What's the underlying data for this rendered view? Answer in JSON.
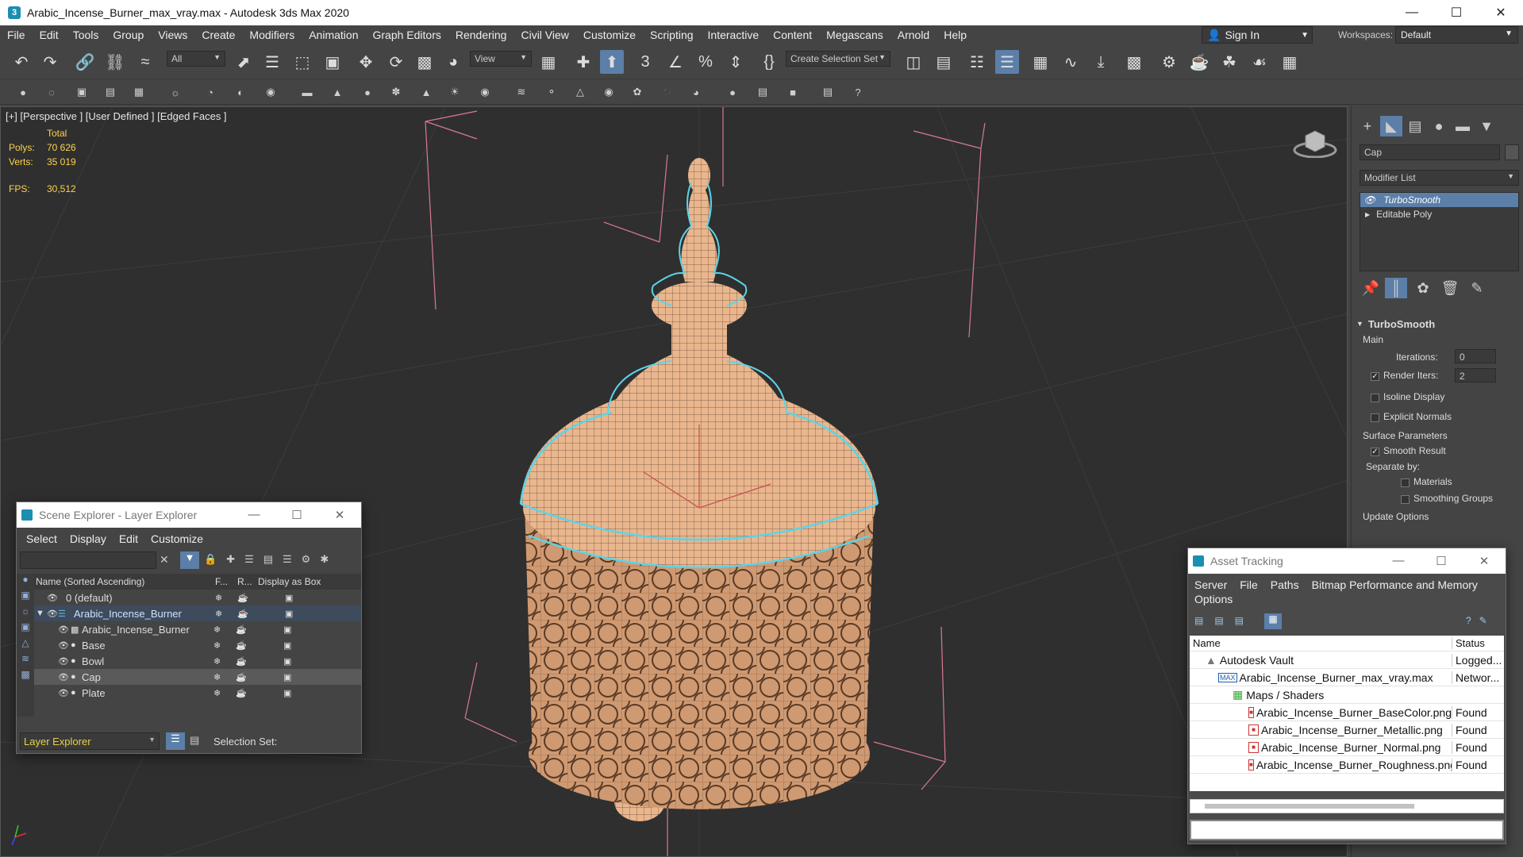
{
  "window": {
    "title": "Arabic_Incense_Burner_max_vray.max - Autodesk 3ds Max 2020"
  },
  "menu": [
    "File",
    "Edit",
    "Tools",
    "Group",
    "Views",
    "Create",
    "Modifiers",
    "Animation",
    "Graph Editors",
    "Rendering",
    "Civil View",
    "Customize",
    "Scripting",
    "Interactive",
    "Content",
    "Megascans",
    "Arnold",
    "Help"
  ],
  "account": {
    "sign_in": "Sign In",
    "workspaces_label": "Workspaces:",
    "workspace": "Default"
  },
  "toolbar": {
    "selection_filter": "All",
    "ref_coord": "View",
    "selection_set_placeholder": "Create Selection Set"
  },
  "viewport": {
    "label": "[+] [Perspective ] [User Defined ] [Edged Faces ]",
    "stats": {
      "total_label": "Total",
      "polys_label": "Polys:",
      "polys": "70 626",
      "verts_label": "Verts:",
      "verts": "35 019",
      "fps_label": "FPS:",
      "fps": "30,512"
    }
  },
  "command_panel": {
    "object_name": "Cap",
    "modifier_list": "Modifier List",
    "stack": [
      "TurboSmooth",
      "Editable Poly"
    ],
    "rollout_title": "TurboSmooth",
    "main_label": "Main",
    "iterations_label": "Iterations:",
    "iterations": "0",
    "render_iters_label": "Render Iters:",
    "render_iters": "2",
    "isoline": "Isoline Display",
    "explicit_normals": "Explicit Normals",
    "surface_params": "Surface Parameters",
    "smooth_result": "Smooth Result",
    "separate_by": "Separate by:",
    "materials": "Materials",
    "smoothing_groups": "Smoothing Groups",
    "update_options": "Update Options"
  },
  "scene_explorer": {
    "title": "Scene Explorer - Layer Explorer",
    "menu": [
      "Select",
      "Display",
      "Edit",
      "Customize"
    ],
    "columns": {
      "name": "Name (Sorted Ascending)",
      "f": "F...",
      "r": "R...",
      "box": "Display as Box"
    },
    "rows": [
      {
        "name": "0 (default)"
      },
      {
        "name": "Arabic_Incense_Burner"
      },
      {
        "name": "Arabic_Incense_Burner"
      },
      {
        "name": "Base"
      },
      {
        "name": "Bowl"
      },
      {
        "name": "Cap"
      },
      {
        "name": "Plate"
      }
    ],
    "footer_explorer": "Layer Explorer",
    "footer_selset": "Selection Set:"
  },
  "asset_tracking": {
    "title": "Asset Tracking",
    "menu": [
      "Server",
      "File",
      "Paths",
      "Bitmap Performance and Memory"
    ],
    "menu2": "Options",
    "columns": {
      "name": "Name",
      "status": "Status"
    },
    "rows": [
      {
        "name": "Autodesk Vault",
        "status": "Logged..."
      },
      {
        "name": "Arabic_Incense_Burner_max_vray.max",
        "status": "Networ..."
      },
      {
        "name": "Maps / Shaders",
        "status": ""
      },
      {
        "name": "Arabic_Incense_Burner_BaseColor.png",
        "status": "Found"
      },
      {
        "name": "Arabic_Incense_Burner_Metallic.png",
        "status": "Found"
      },
      {
        "name": "Arabic_Incense_Burner_Normal.png",
        "status": "Found"
      },
      {
        "name": "Arabic_Incense_Burner_Roughness.png",
        "status": "Found"
      }
    ]
  },
  "colors": {
    "accent": "#5b7fa8",
    "selection": "#5bd4e8",
    "mesh": "#e9b68e",
    "stats": "#ffd24a"
  }
}
